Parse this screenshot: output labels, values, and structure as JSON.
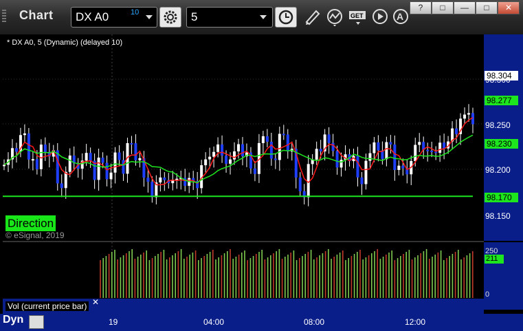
{
  "window": {
    "title": "Chart",
    "buttons": [
      "?",
      "□",
      "—",
      "✕"
    ]
  },
  "toolbar": {
    "symbol": "DX A0",
    "delay_badge": "10",
    "interval": "5",
    "icons": [
      "settings-icon",
      "clock-icon",
      "pencil-icon",
      "study-icon",
      "get-icon",
      "play-icon",
      "alert-icon"
    ]
  },
  "legend": {
    "title": "* DX A0, 5 (Dynamic) (delayed 10)"
  },
  "overlay": {
    "direction_label": "Direction",
    "copyright": "© eSignal, 2019"
  },
  "price_axis": {
    "ticks": [
      "98.300",
      "98.250",
      "98.200",
      "98.150"
    ],
    "tags": [
      {
        "label": "98.304",
        "style": "white"
      },
      {
        "label": "98.277",
        "style": "green"
      },
      {
        "label": "98.230",
        "style": "green"
      },
      {
        "label": "98.170",
        "style": "green"
      }
    ]
  },
  "volume_pane": {
    "label": "Vol (current price bar)",
    "close": "✕",
    "ticks": [
      "250",
      "0"
    ],
    "current_tag": "211"
  },
  "time_axis": {
    "mode": "Dyn",
    "labels": [
      "19",
      "04:00",
      "08:00",
      "12:00"
    ]
  },
  "colors": {
    "up_bar": "#ffffff",
    "down_bar": "#1f3fff",
    "ma_red": "#ff1a1a",
    "ma_green": "#1ee61e",
    "axis_bg": "#0a1e8a",
    "vol_up": "#7ecb4f",
    "vol_down": "#c0392b"
  }
}
